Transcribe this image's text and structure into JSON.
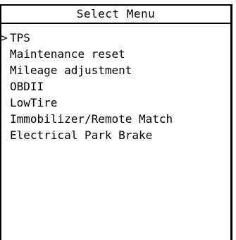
{
  "header": {
    "title": "Select Menu"
  },
  "menu": {
    "cursor_glyph": ">",
    "selected_index": 0,
    "items": [
      {
        "label": "TPS"
      },
      {
        "label": "Maintenance reset"
      },
      {
        "label": "Mileage adjustment"
      },
      {
        "label": "OBDII"
      },
      {
        "label": "LowTire"
      },
      {
        "label": "Immobilizer/Remote Match"
      },
      {
        "label": "Electrical Park Brake"
      }
    ]
  }
}
